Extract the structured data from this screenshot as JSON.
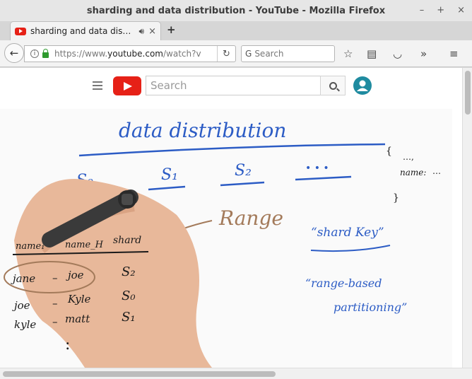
{
  "window": {
    "title": "sharding and data distribution - YouTube - Mozilla Firefox",
    "minimize": "–",
    "maximize": "+",
    "close": "×"
  },
  "tabs": [
    {
      "label": "sharding and data dis…",
      "audio_icon": "speaker-icon",
      "close": "×"
    }
  ],
  "newtab": "+",
  "navbar": {
    "url_prefix": "https://www.",
    "url_domain": "youtube.com",
    "url_path": "/watch?v",
    "search_engine_icon": "G",
    "search_placeholder": "Search"
  },
  "youtube": {
    "search_placeholder": "Search"
  },
  "whiteboard": {
    "heading": "data distribution",
    "shard_labels": [
      "S₀",
      "S₁",
      "S₂",
      "• • •"
    ],
    "range_label": "Range",
    "table_headers": [
      "name₁",
      "name_H",
      "shard"
    ],
    "rows": [
      {
        "from": "jane",
        "to": "joe",
        "shard": "S₂"
      },
      {
        "from": "joe",
        "to": "Kyle",
        "shard": "S₀"
      },
      {
        "from": "kyle",
        "to": "matt",
        "shard": "S₁"
      }
    ],
    "ellipsis": ":",
    "shard_key": "“shard Key”",
    "partitioning_line1": "“range-based",
    "partitioning_line2": "partitioning”",
    "json_snippet": [
      "{",
      "…,",
      "name:",
      "…",
      "}"
    ]
  },
  "colors": {
    "ink_blue": "#2c5cc5",
    "ink_black": "#1a1a1a",
    "ink_brown": "#a37a5a",
    "yt_red": "#e62117"
  }
}
